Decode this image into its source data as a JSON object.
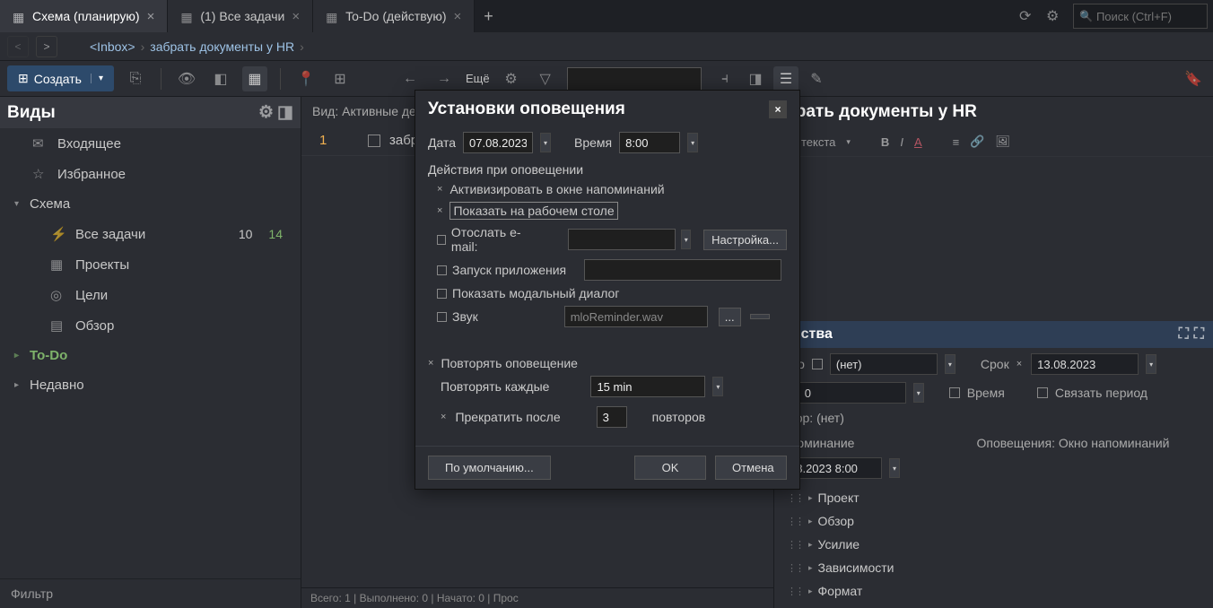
{
  "tabs": [
    {
      "label": "Схема (планирую)"
    },
    {
      "label": "(1) Все задачи"
    },
    {
      "label": "To-Do (действую)"
    }
  ],
  "search_placeholder": "Поиск (Ctrl+F)",
  "breadcrumb": {
    "inbox": "<Inbox>",
    "item": "забрать документы у HR"
  },
  "create_label": "Создать",
  "more_label": "Ещё",
  "sidebar": {
    "title": "Виды",
    "items": [
      {
        "label": "Входящее",
        "icon": "envelope"
      },
      {
        "label": "Избранное",
        "icon": "star"
      },
      {
        "label": "Схема",
        "icon": ""
      },
      {
        "label": "Все задачи",
        "icon": "list",
        "count": "10",
        "count2": "14"
      },
      {
        "label": "Проекты",
        "icon": "boxes"
      },
      {
        "label": "Цели",
        "icon": "target"
      },
      {
        "label": "Обзор",
        "icon": "calendar"
      },
      {
        "label": "To-Do",
        "icon": ""
      },
      {
        "label": "Недавно",
        "icon": ""
      }
    ],
    "filter": "Фильтр"
  },
  "center": {
    "view_label": "Вид: Активные дей",
    "task_num": "1",
    "task_label": "забрать док",
    "footer": "Всего: 1 | Выполнено: 0 | Начато: 0 | Прос"
  },
  "right": {
    "title": "брать документы у HR",
    "style_label": "ль текста",
    "props_title": "ойства",
    "start_label": "ало",
    "start_value": "(нет)",
    "due_label": "Срок",
    "due_value": "13.08.2023",
    "dur_label": "т.",
    "dur_value": "0",
    "time_label": "Время",
    "link_label": "Связать период",
    "calendar_label": "атор: (нет)",
    "reminder_label": "апоминание",
    "reminder_value": "08.2023 8:00",
    "notif_label": "Оповещения: Окно напоминаний",
    "sections": [
      "Проект",
      "Обзор",
      "Усилие",
      "Зависимости",
      "Формат"
    ]
  },
  "dialog": {
    "title": "Установки оповещения",
    "date_label": "Дата",
    "date_value": "07.08.2023",
    "time_label": "Время",
    "time_value": "8:00",
    "actions_label": "Действия при оповещении",
    "action_activate": "Активизировать в окне напоминаний",
    "action_desktop": "Показать на рабочем столе",
    "action_email": "Отослать e-mail:",
    "email_settings": "Настройка...",
    "action_app": "Запуск приложения",
    "action_modal": "Показать модальный диалог",
    "action_sound": "Звук",
    "sound_value": "mloReminder.wav",
    "repeat_label": "Повторять оповещение",
    "repeat_every": "Повторять каждые",
    "repeat_interval": "15 min",
    "stop_after": "Прекратить после",
    "stop_count": "3",
    "stop_unit": "повторов",
    "defaults": "По умолчанию...",
    "ok": "OK",
    "cancel": "Отмена"
  }
}
